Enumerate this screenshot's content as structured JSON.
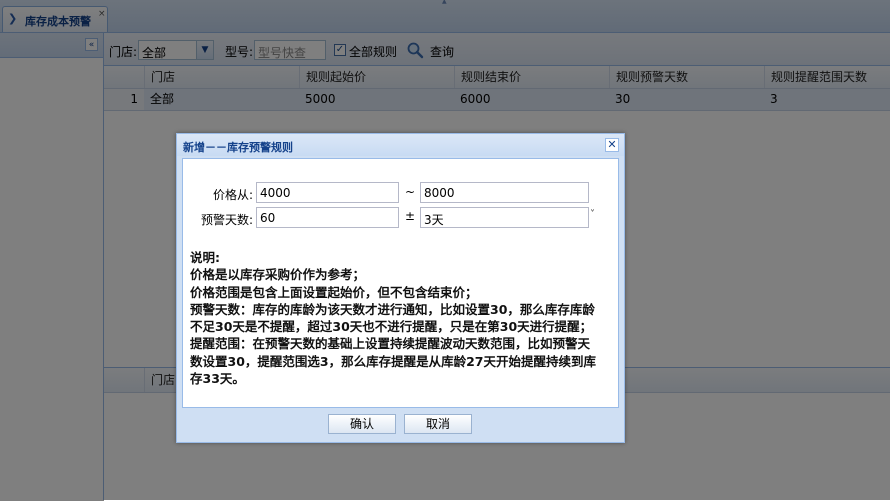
{
  "tab": {
    "label": "库存成本预警",
    "close": "×"
  },
  "toolbar": {
    "store_label": "门店:",
    "store_value": "全部",
    "model_label": "型号:",
    "model_placeholder": "型号快查",
    "all_rules_label": "全部规则",
    "all_rules_checked": true,
    "query_label": "查询"
  },
  "grid": {
    "columns": [
      "门店",
      "规则起始价",
      "规则结束价",
      "规则预警天数",
      "规则提醒范围天数"
    ],
    "rows": [
      {
        "rownum": "1",
        "cells": [
          "全部",
          "5000",
          "6000",
          "30",
          "3"
        ]
      }
    ]
  },
  "lower_grid": {
    "columns": [
      "门店"
    ]
  },
  "dialog": {
    "title": "新增－－库存预警规则",
    "price_label": "价格从:",
    "price_from": "4000",
    "price_tilde": "~",
    "price_to": "8000",
    "days_label": "预警天数:",
    "days_value": "60",
    "days_pm": "±",
    "range_value": "3天",
    "notes": [
      "说明:",
      "价格是以库存采购价作为参考；",
      "价格范围是包含上面设置起始价，但不包含结束价；",
      "预警天数：库存的库龄为该天数才进行通知，比如设置30，那么库存库龄",
      "不足30天是不提醒，超过30天也不进行提醒，只是在第30天进行提醒；",
      "提醒范围：在预警天数的基础上设置持续提醒波动天数范围，比如预警天",
      "数设置30，提醒范围选3，那么库存提醒是从库龄27天开始提醒持续到库",
      "存33天。"
    ],
    "confirm_label": "确认",
    "cancel_label": "取消"
  }
}
